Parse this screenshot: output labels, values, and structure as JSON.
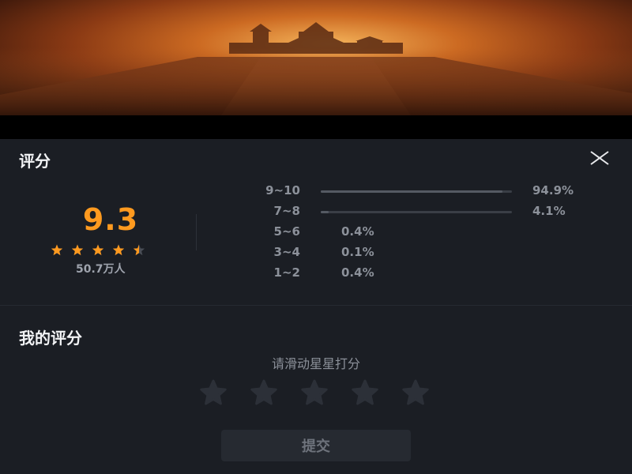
{
  "header": {
    "title": "评分",
    "close_icon": "close-icon"
  },
  "summary": {
    "score": "9.3",
    "stars_filled": 4.5,
    "stars_total": 5,
    "star_color": "#ff9a1f",
    "raters": "50.7万人"
  },
  "distribution": [
    {
      "label": "9~10",
      "percent": "94.9%",
      "fraction": 0.949
    },
    {
      "label": "7~8",
      "percent": "4.1%",
      "fraction": 0.041
    },
    {
      "label": "5~6",
      "percent": "0.4%",
      "fraction": 0.004
    },
    {
      "label": "3~4",
      "percent": "0.1%",
      "fraction": 0.001
    },
    {
      "label": "1~2",
      "percent": "0.4%",
      "fraction": 0.004
    }
  ],
  "my_rating": {
    "title": "我的评分",
    "hint": "请滑动星星打分",
    "star_count": 5,
    "submit_label": "提交"
  },
  "colors": {
    "accent": "#ff9a1f",
    "background": "#1b1e24"
  }
}
